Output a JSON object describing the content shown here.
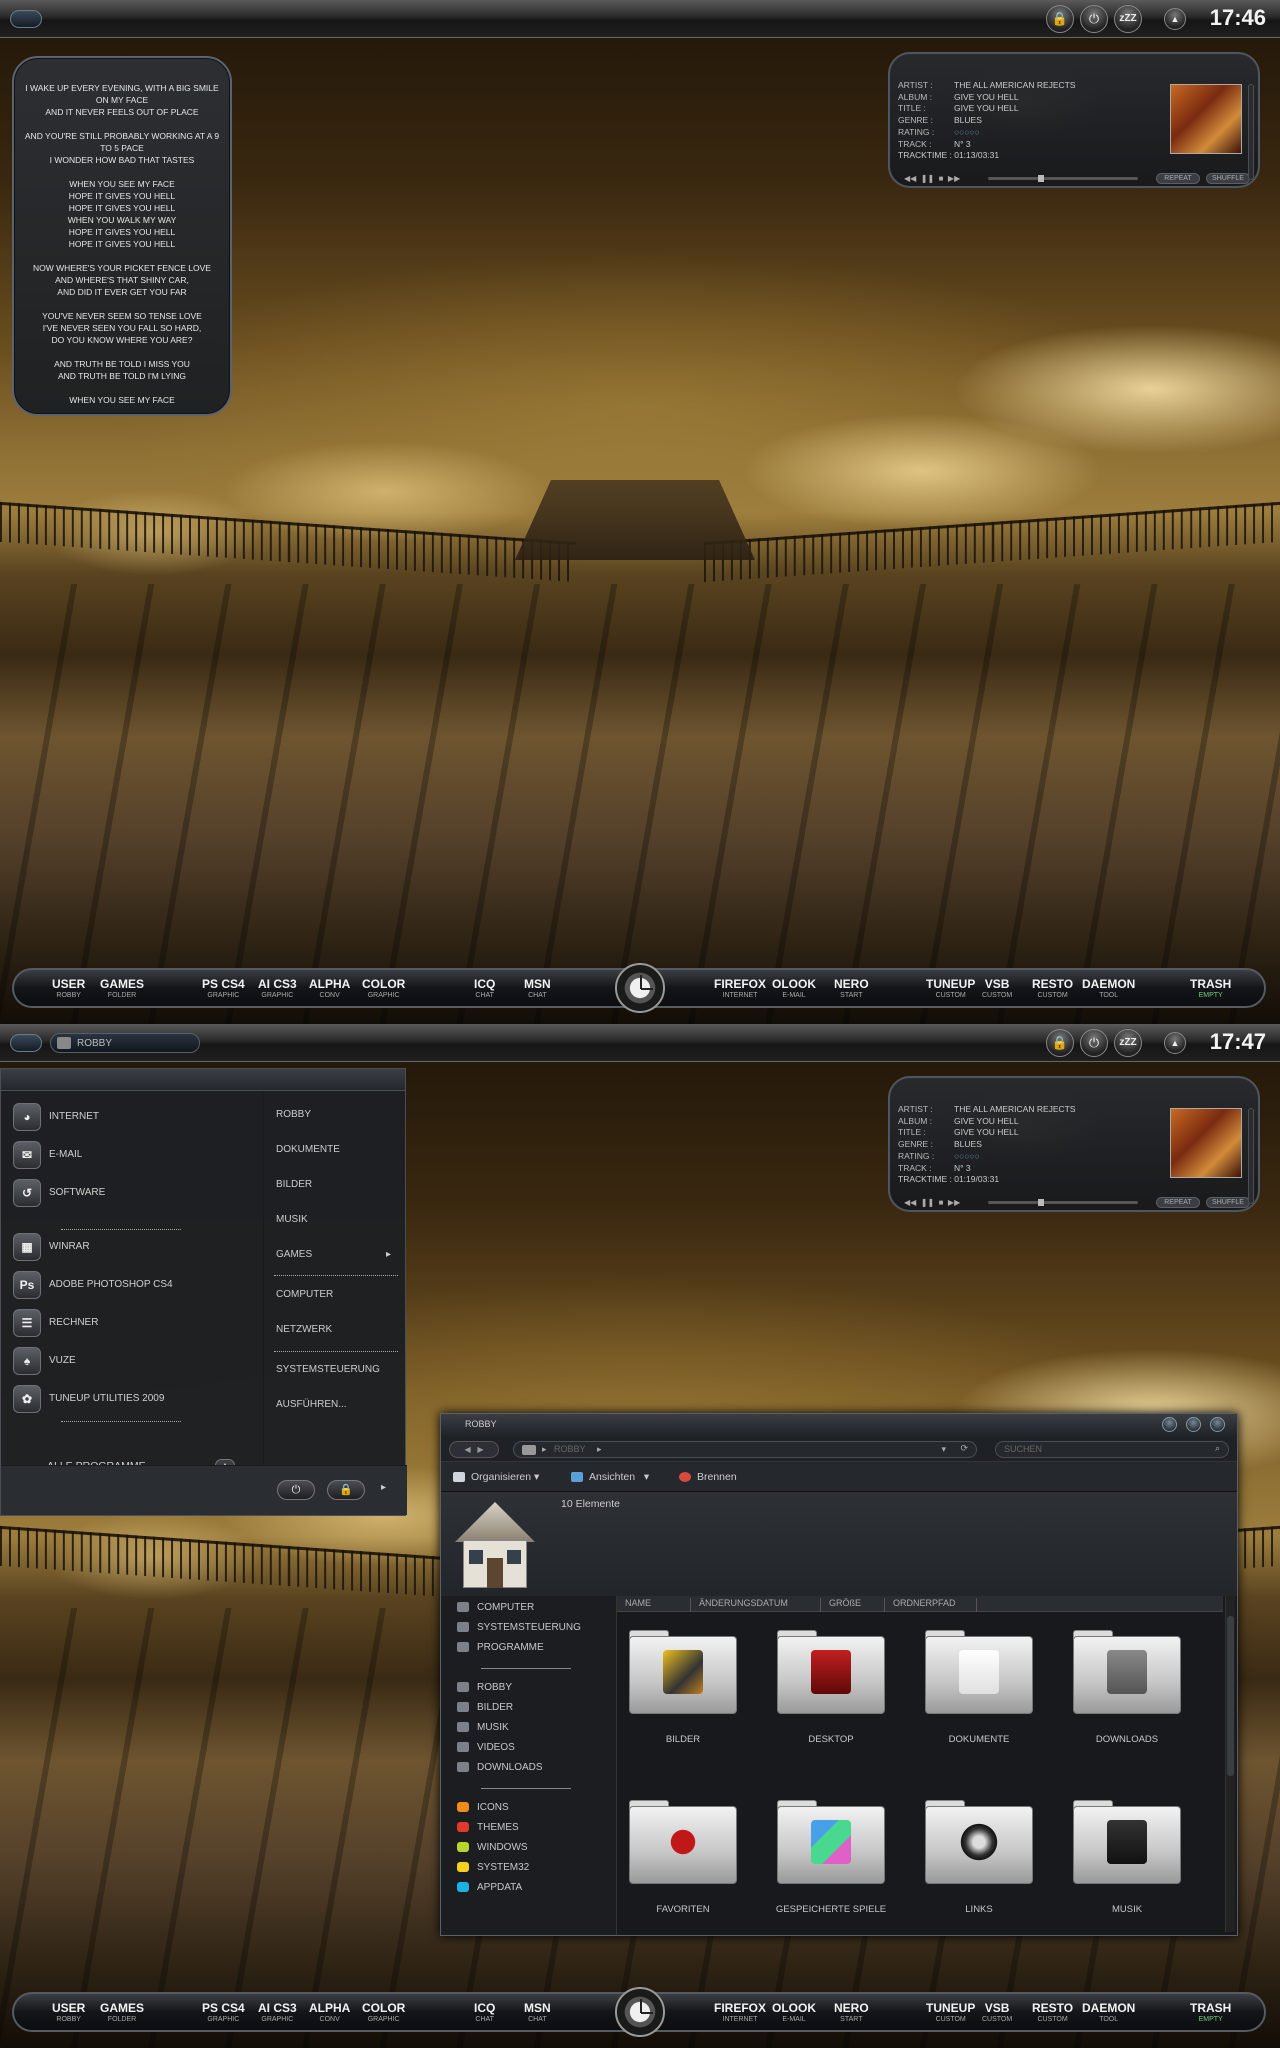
{
  "screen1": {
    "clock": "17:46",
    "lyrics": [
      "I WAKE UP EVERY EVENING, WITH A BIG SMILE ON MY FACE",
      "AND IT NEVER FEELS OUT OF PLACE",
      "",
      "AND YOU'RE STILL PROBABLY WORKING AT A 9 TO 5 PACE",
      "I WONDER HOW BAD THAT TASTES",
      "",
      "WHEN YOU SEE MY FACE",
      "HOPE IT GIVES YOU HELL",
      "HOPE IT GIVES YOU HELL",
      "WHEN YOU WALK MY WAY",
      "HOPE IT GIVES YOU HELL",
      "HOPE IT GIVES YOU HELL",
      "",
      "NOW WHERE'S YOUR PICKET FENCE LOVE",
      "AND WHERE'S THAT SHINY CAR,",
      "AND DID IT EVER GET YOU FAR",
      "",
      "YOU'VE NEVER SEEM SO TENSE LOVE",
      "I'VE NEVER SEEN YOU FALL SO HARD,",
      "DO YOU KNOW WHERE YOU ARE?",
      "",
      "AND TRUTH BE TOLD I MISS YOU",
      "AND TRUTH BE TOLD I'M LYING",
      "",
      "WHEN YOU SEE MY FACE"
    ],
    "player": {
      "tracktime": "01:13/03:31"
    }
  },
  "screen2": {
    "clock": "17:47",
    "user_pill": "ROBBY",
    "player": {
      "tracktime": "01:19/03:31"
    }
  },
  "player_common": {
    "artist_k": "ARTIST :",
    "artist": "THE ALL AMERICAN REJECTS",
    "album_k": "ALBUM :",
    "album": "GIVE YOU HELL",
    "title_k": "TITLE :",
    "title": "GIVE YOU HELL",
    "genre_k": "GENRE :",
    "genre": "BLUES",
    "rating_k": "RATING :",
    "rating": "○○○○○",
    "track_k": "TRACK :",
    "track": "N° 3",
    "tracktime_k": "TRACKTIME :",
    "repeat": "REPEAT",
    "shuffle": "SHUFFLE"
  },
  "dock": [
    {
      "n": "USER",
      "s": "ROBBY"
    },
    {
      "n": "GAMES",
      "s": "FOLDER"
    },
    {
      "n": "PS CS4",
      "s": "GRAPHIC"
    },
    {
      "n": "AI CS3",
      "s": "GRAPHIC"
    },
    {
      "n": "ALPHA",
      "s": "CONV"
    },
    {
      "n": "COLOR",
      "s": "GRAPHIC"
    },
    {
      "n": "ICQ",
      "s": "CHAT"
    },
    {
      "n": "MSN",
      "s": "CHAT"
    },
    {
      "n": "FIREFOX",
      "s": "INTERNET"
    },
    {
      "n": "OLOOK",
      "s": "E-MAIL"
    },
    {
      "n": "NERO",
      "s": "START"
    },
    {
      "n": "TUNEUP",
      "s": "CUSTOM"
    },
    {
      "n": "VSB",
      "s": "CUSTOM"
    },
    {
      "n": "RESTO",
      "s": "CUSTOM"
    },
    {
      "n": "DAEMON",
      "s": "TOOL"
    },
    {
      "n": "TRASH",
      "s": "EMPTY"
    }
  ],
  "startmenu": {
    "programs": [
      {
        "label": "INTERNET",
        "icon": "firefox-icon",
        "glyph": "◕"
      },
      {
        "label": "E-MAIL",
        "icon": "mail-icon",
        "glyph": "✉"
      },
      {
        "label": "SOFTWARE",
        "icon": "software-icon",
        "glyph": "↺"
      },
      {
        "label": "WINRAR",
        "icon": "winrar-icon",
        "glyph": "▦"
      },
      {
        "label": "ADOBE PHOTOSHOP CS4",
        "icon": "photoshop-icon",
        "glyph": "Ps"
      },
      {
        "label": "RECHNER",
        "icon": "calculator-icon",
        "glyph": "☰"
      },
      {
        "label": "VUZE",
        "icon": "vuze-icon",
        "glyph": "♠"
      },
      {
        "label": "TUNEUP UTILITIES 2009",
        "icon": "tuneup-icon",
        "glyph": "✿"
      }
    ],
    "all_programs": "ALLE PROGRAMME",
    "places": [
      "ROBBY",
      "DOKUMENTE",
      "BILDER",
      "MUSIK",
      "GAMES",
      "COMPUTER",
      "NETZWERK",
      "SYSTEMSTEUERUNG",
      "AUSFÜHREN..."
    ]
  },
  "explorer": {
    "title": "ROBBY",
    "address": "ROBBY",
    "search": "SUCHEN",
    "toolbar": [
      "Organisieren",
      "Ansichten",
      "Brennen"
    ],
    "count": "10 Elemente",
    "nav": [
      "COMPUTER",
      "SYSTEMSTEUERUNG",
      "PROGRAMME",
      "ROBBY",
      "BILDER",
      "MUSIK",
      "VIDEOS",
      "DOWNLOADS",
      "ICONS",
      "THEMES",
      "WINDOWS",
      "SYSTEM32",
      "APPDATA"
    ],
    "nav_colors": [
      "#f08a1c",
      "#e23a2a",
      "#b6d62c",
      "#f2d21c",
      "#1ab2e0"
    ],
    "columns": [
      "NAME",
      "ÄNDERUNGSDATUM",
      "GRÖßE",
      "ORDNERPFAD"
    ],
    "folders": [
      "BILDER",
      "DESKTOP",
      "DOKUMENTE",
      "DOWNLOADS",
      "FAVORITEN",
      "GESPEICHERTE SPIELE",
      "LINKS",
      "MUSIK"
    ]
  }
}
